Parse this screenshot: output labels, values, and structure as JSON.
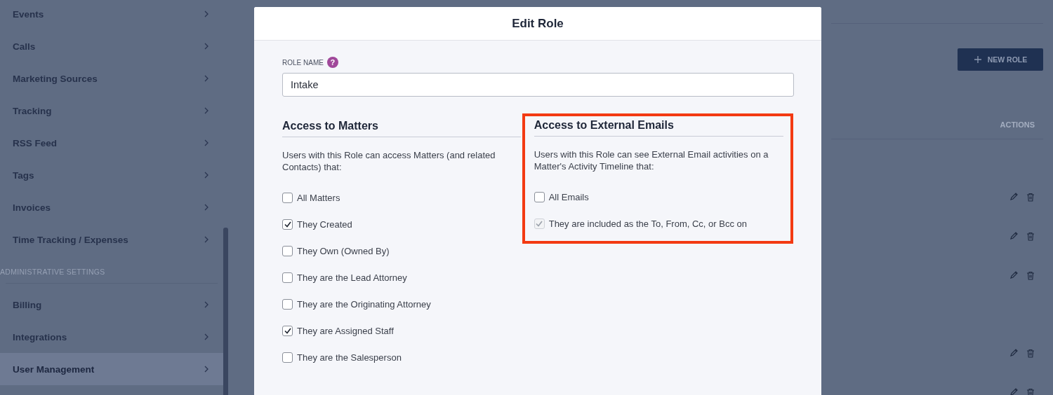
{
  "sidebar": {
    "items": [
      {
        "label": "Events",
        "selected": false
      },
      {
        "label": "Calls",
        "selected": false
      },
      {
        "label": "Marketing Sources",
        "selected": false
      },
      {
        "label": "Tracking",
        "selected": false
      },
      {
        "label": "RSS Feed",
        "selected": false
      },
      {
        "label": "Tags",
        "selected": false
      },
      {
        "label": "Invoices",
        "selected": false
      },
      {
        "label": "Time Tracking / Expenses",
        "selected": false
      }
    ],
    "section_title": "ADMINISTRATIVE SETTINGS",
    "admin_items": [
      {
        "label": "Billing",
        "selected": false
      },
      {
        "label": "Integrations",
        "selected": false
      },
      {
        "label": "User Management",
        "selected": true
      }
    ]
  },
  "modal": {
    "title": "Edit Role",
    "role_name": {
      "label": "ROLE NAME",
      "help": "?",
      "value": "Intake"
    },
    "sections": [
      {
        "heading": "Access to Matters",
        "highlighted": false,
        "description": "Users with this Role can access Matters (and related Contacts) that:",
        "options": [
          {
            "label": "All Matters",
            "checked": false,
            "disabled": false
          },
          {
            "label": "They Created",
            "checked": true,
            "disabled": false
          },
          {
            "label": "They Own (Owned By)",
            "checked": false,
            "disabled": false
          },
          {
            "label": "They are the Lead Attorney",
            "checked": false,
            "disabled": false
          },
          {
            "label": "They are the Originating Attorney",
            "checked": false,
            "disabled": false
          },
          {
            "label": "They are Assigned Staff",
            "checked": true,
            "disabled": false
          },
          {
            "label": "They are the Salesperson",
            "checked": false,
            "disabled": false
          }
        ]
      },
      {
        "heading": "Access to External Emails",
        "highlighted": true,
        "description": "Users with this Role can see External Email activities on a Matter's Activity Timeline that:",
        "options": [
          {
            "label": "All Emails",
            "checked": false,
            "disabled": false
          },
          {
            "label": "They are included as the To, From, Cc, or Bcc on",
            "checked": true,
            "disabled": true
          }
        ]
      }
    ]
  },
  "roles_panel": {
    "new_role_button": "NEW ROLE",
    "actions_header": "ACTIONS",
    "rows": [
      {
        "kind": "actions"
      },
      {
        "kind": "actions"
      },
      {
        "kind": "actions"
      },
      {
        "kind": "blank"
      },
      {
        "kind": "actions"
      },
      {
        "kind": "actions"
      }
    ]
  }
}
